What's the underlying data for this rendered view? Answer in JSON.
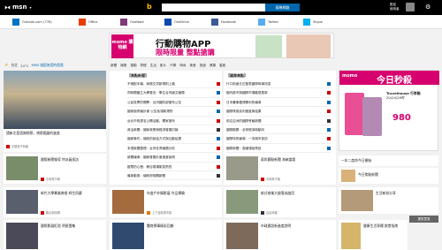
{
  "header": {
    "brand": "msn",
    "bing": "b",
    "search_button": "搜尋網路",
    "search_placeholder": "",
    "user_line1": "歡迎",
    "user_line2": "使用者"
  },
  "apps": [
    {
      "label": "Outlook.com (776)",
      "color": "#0072c6"
    },
    {
      "label": "Office",
      "color": "#eb3c00"
    },
    {
      "label": "OneNote",
      "color": "#80397b"
    },
    {
      "label": "OneDrive",
      "color": "#094ab2"
    },
    {
      "label": "Facebook",
      "color": "#3b5998"
    },
    {
      "label": "Twitter",
      "color": "#55acee"
    },
    {
      "label": "Skype",
      "color": "#00aff0"
    }
  ],
  "banner": {
    "brand": "momo 購物網",
    "headline": "行動購物APP",
    "subline": "限時限量 整點搶購"
  },
  "weather": {
    "city": "台北",
    "temp": "24°C",
    "link": "MSN 協設為您的首頁"
  },
  "nav": [
    "新聞",
    "娛樂",
    "運動",
    "財經",
    "生活",
    "影片",
    "汽車",
    "時尚",
    "美食",
    "旅遊",
    "健康",
    "星座"
  ],
  "lead": {
    "caption": "請新北皇邁謝視察，視察國展的進度",
    "source": "中國電子時報"
  },
  "hot": {
    "title": "【焦點新聞】",
    "items": [
      "不適配手機，商務交貨新規則上路",
      "同時間國立大學發言：學生台灣論文議題",
      "公民投票的開票：台灣國防部發布公告",
      "國家面會議計畫 公告各項新規則",
      "台北市長提名公開活動，獨家發布",
      "政治新聞：國家政策與經濟發展討論",
      "國家事件：總統的說話方式與互動結果",
      "本週新聞整理：台灣社會議題分析",
      "新聞報導：國家發展計畫進度說明",
      "觀眾的心聲：節目現場氣氛熱烈",
      "最新動態：總統府相關新聞"
    ]
  },
  "intl": {
    "title": "【國際焦點】",
    "items": [
      "行口前面五位發表國際時事訊息",
      "國內股市與國際市場動態更新",
      "日本賽事獲得勝利的報導",
      "國際貿易談判進度與結果",
      "前往亞洲的國際會議新聞",
      "國際觀察：全球經濟新動向",
      "國際特別報導：一流城市探訪",
      "國際新聞：各國領袖會談",
      "海外僑胞活動報導與花絮",
      "國際經濟：產業鏈變動觀察",
      "全球科技：新產品發表會"
    ]
  },
  "ad": {
    "brand": "momo",
    "headline": "今日秒殺",
    "product": "Travelhouse 行李箱",
    "detail": "20/24/29吋",
    "price": "980"
  },
  "stories": [
    {
      "caption": "國際新聞報導 特派員採訪",
      "source": "中時電子報"
    },
    {
      "caption": "兩岸觀點新聞 海峽論壇",
      "source": "中時電子報"
    },
    {
      "caption": "新竹大學畢業典禮 師生同慶",
      "source": "聯合新聞網"
    },
    {
      "caption": "年度戶外攝影展 作品揭曉",
      "source": "上下游新聞市集"
    },
    {
      "caption": "新式商業大樓落成啟用",
      "source": "自由時報"
    },
    {
      "caption": "國際影展紅毯 明星雲集",
      "source": "中時電子報"
    },
    {
      "caption": "體育賽事精彩回顧",
      "source": "中時電子報"
    },
    {
      "caption": "市政建設新進度說明",
      "source": "聯合新聞網"
    },
    {
      "caption": "健康生活專欄 飲食指南",
      "source": "健康雜誌"
    },
    {
      "caption": "藝文活動現場報導",
      "source": "自由時報"
    }
  ],
  "side": {
    "item1": "一年二度命今日開始",
    "item2": "今日焦點新聞",
    "item3": "生活新知分享",
    "feedback": "提供意見"
  }
}
